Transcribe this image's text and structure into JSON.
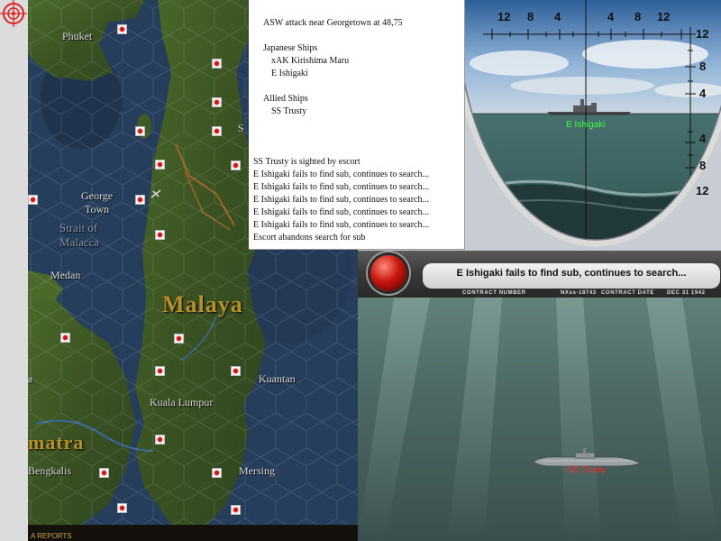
{
  "map": {
    "labels": {
      "phuket": "Phuket",
      "george_town": "George\nTown",
      "strait": "Strait of\nMalacca",
      "medan": "Medan",
      "malaya": "Malaya",
      "kuantan": "Kuantan",
      "kuala_lumpur": "Kuala Lumpur",
      "sumatra": "matra",
      "mersing": "Mersing",
      "bengkalis": "Bengkalis",
      "partial_s": "S",
      "partial_a": "a"
    },
    "bottom_text": "A REPORTS"
  },
  "report": {
    "title": "ASW attack near Georgetown  at 48,75",
    "japanese_header": "Japanese Ships",
    "japanese_ships": [
      "xAK Kirishima Maru",
      "E Ishigaki"
    ],
    "allied_header": "Allied Ships",
    "allied_ships": [
      "SS Trusty"
    ],
    "log": [
      "SS Trusty is sighted by escort",
      "E Ishigaki fails to find sub, continues to search...",
      "E Ishigaki fails to find sub, continues to search...",
      "E Ishigaki fails to find sub, continues to search...",
      "E Ishigaki fails to find sub, continues to search...",
      "E Ishigaki fails to find sub, continues to search...",
      "Escort abandons search for sub"
    ]
  },
  "periscope": {
    "scale_top": [
      "12",
      "8",
      "4",
      "4",
      "8",
      "12"
    ],
    "scale_right": [
      "12",
      "8",
      "4",
      "4",
      "8",
      "12"
    ],
    "ship_label": "E Ishigaki"
  },
  "sub_panel": {
    "status": "E Ishigaki fails to find sub, continues to search...",
    "contract_number_label": "CONTRACT NUMBER",
    "contract_number": "NXss-18743",
    "contract_date_label": "CONTRACT DATE",
    "contract_date": "DEC 31 1942",
    "sub_label": "SS Trusty"
  },
  "colors": {
    "japanese_label": "#3cff3c",
    "allied_label": "#ff2a2a",
    "sea": "#263e5c",
    "land": "#3f5a24"
  }
}
